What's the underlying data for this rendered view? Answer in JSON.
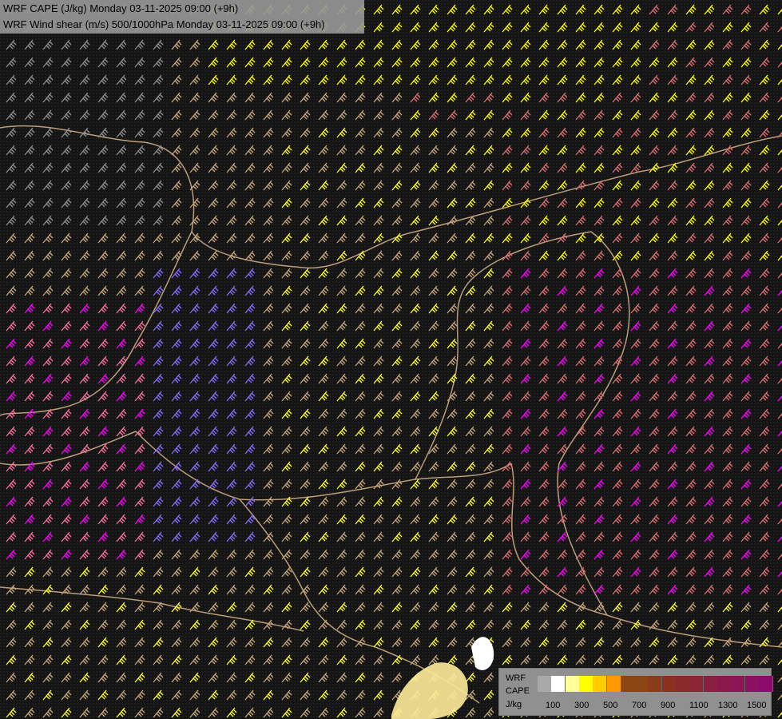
{
  "title": {
    "line1": "WRF CAPE (J/kg) Monday 03-11-2025 09:00 (+9h)",
    "line2": "WRF Wind shear (m/s) 500/1000hPa Monday 03-11-2025 09:00 (+9h)"
  },
  "legend": {
    "label_model": "WRF",
    "label_var": "CAPE",
    "label_unit": "J/kg",
    "ticks": [
      "100",
      "300",
      "500",
      "700",
      "900",
      "1100",
      "1300",
      "1500"
    ],
    "colors": [
      "#a8a8a8",
      "#ffffff",
      "#ffff99",
      "#ffff00",
      "#ffcc00",
      "#ff9900",
      "#8b4513",
      "#8b4513",
      "#8b3a1a",
      "#8b3020",
      "#8b2a2a",
      "#8b2535",
      "#8b1f40",
      "#8b1a4a",
      "#8b1555",
      "#8b1060",
      "#8b0a6a"
    ]
  },
  "barb_colors": {
    "low": "#ff00ff",
    "mid_pink": "#ff6fa0",
    "salmon": "#e07070",
    "tan": "#c8a878",
    "yellow": "#ffff33",
    "bright_yellow": "#ffff00",
    "purple": "#8c6cff",
    "grey": "#909090",
    "border": "#d9b48a"
  },
  "map_features": {
    "land_color": "#2b2b2b",
    "water_spots": "#ffffff",
    "cape_patch_color": "#ffeb99"
  }
}
